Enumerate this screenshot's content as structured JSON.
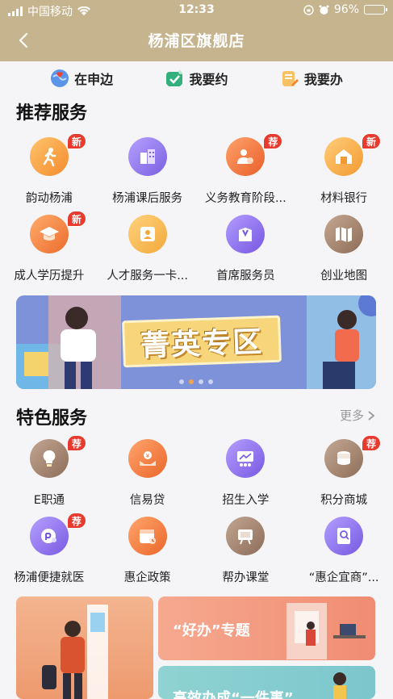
{
  "status_bar": {
    "carrier": "中国移动",
    "time": "12:33",
    "battery": "96%"
  },
  "header": {
    "title": "杨浦区旗舰店"
  },
  "quick_links": [
    {
      "label": "在申边",
      "icon": "globe-heart-icon",
      "color": "#3f7fe0"
    },
    {
      "label": "我要约",
      "icon": "calendar-check-icon",
      "color": "#2faa78"
    },
    {
      "label": "我要办",
      "icon": "document-edit-icon",
      "color": "#f1a53b"
    }
  ],
  "recommended": {
    "title": "推荐服务",
    "items": [
      {
        "label": "韵动杨浦",
        "icon": "runner-icon",
        "color": "#f5a03a",
        "badge": "新"
      },
      {
        "label": "杨浦课后服务",
        "icon": "building-icon",
        "color": "#8c74e8",
        "badge": ""
      },
      {
        "label": "义务教育阶段...",
        "icon": "teacher-icon",
        "color": "#f07a3c",
        "badge": "荐"
      },
      {
        "label": "材料银行",
        "icon": "house-icon",
        "color": "#f4a23c",
        "badge": "新"
      },
      {
        "label": "成人学历提升",
        "icon": "graduation-cap-icon",
        "color": "#f0843a",
        "badge": "新"
      },
      {
        "label": "人才服务一卡...",
        "icon": "id-card-icon",
        "color": "#f4b54a",
        "badge": ""
      },
      {
        "label": "首席服务员",
        "icon": "service-staff-icon",
        "color": "#8d72e6",
        "badge": ""
      },
      {
        "label": "创业地图",
        "icon": "map-icon",
        "color": "#a2826c",
        "badge": ""
      }
    ]
  },
  "banner": {
    "text": "菁英专区",
    "slides": 4,
    "active_slide": 2
  },
  "featured": {
    "title": "特色服务",
    "more_label": "更多",
    "items": [
      {
        "label": "E职通",
        "icon": "lightbulb-icon",
        "color": "#9d7b66",
        "badge": "荐"
      },
      {
        "label": "信易贷",
        "icon": "hands-money-icon",
        "color": "#f07e3c",
        "badge": ""
      },
      {
        "label": "招生入学",
        "icon": "classroom-icon",
        "color": "#8d73e6",
        "badge": ""
      },
      {
        "label": "积分商城",
        "icon": "coins-icon",
        "color": "#a2826b",
        "badge": "荐"
      },
      {
        "label": "杨浦便捷就医",
        "icon": "medical-icon",
        "color": "#8e74e8",
        "badge": "荐"
      },
      {
        "label": "惠企政策",
        "icon": "calendar-policy-icon",
        "color": "#f07e3c",
        "badge": ""
      },
      {
        "label": "帮办课堂",
        "icon": "easel-icon",
        "color": "#a3826b",
        "badge": ""
      },
      {
        "label": "“惠企宜商”...",
        "icon": "book-icon",
        "color": "#8e74e8",
        "badge": ""
      }
    ]
  },
  "cards": [
    {
      "title": "",
      "color": "#f0a079"
    },
    {
      "title": "“好办”专题",
      "color": "#f29a80"
    },
    {
      "title": "高效办成“一件事”",
      "color": "#8fd0cf"
    }
  ]
}
